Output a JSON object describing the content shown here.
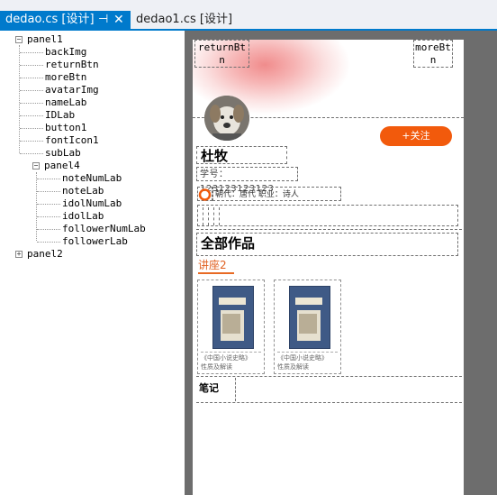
{
  "tabs": {
    "active": {
      "label": "dedao.cs [设计]",
      "pin_icon": "⊣",
      "close_icon": "✕"
    },
    "inactive": {
      "label": "dedao1.cs [设计]"
    }
  },
  "tree": {
    "nodes": [
      "panel1",
      "backImg",
      "returnBtn",
      "moreBtn",
      "avatarImg",
      "nameLab",
      "IDLab",
      "button1",
      "fontIcon1",
      "subLab",
      "panel4",
      "noteNumLab",
      "noteLab",
      "idolNumLab",
      "idolLab",
      "followerNumLab",
      "followerLab",
      "panel2"
    ],
    "expand_minus": "−",
    "expand_plus": "+"
  },
  "designer": {
    "return_btn": "returnBtn",
    "more_btn": "moreBtn",
    "follow_btn": "+关注",
    "name": "杜牧",
    "id_label": "学号：123123123123",
    "sub_label": "朝代：唐代    职业：诗人",
    "works_title": "全部作品",
    "lecture_tab": "讲座2",
    "books": [
      {
        "caption1": "《中国小说史略》",
        "caption2": "性质及解读"
      },
      {
        "caption1": "《中国小说史略》",
        "caption2": "性质及解读"
      }
    ],
    "note_label": "笔记"
  },
  "colors": {
    "tab_active": "#007acc",
    "follow_button": "#f25a0c",
    "lecture_text": "#e06020",
    "designer_background": "#6d6d6d"
  }
}
